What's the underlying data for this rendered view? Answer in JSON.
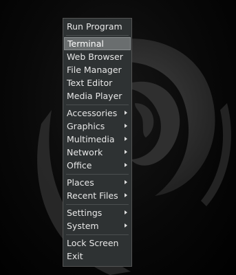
{
  "menu": {
    "run_program": "Run Program",
    "apps": [
      "Terminal",
      "Web Browser",
      "File Manager",
      "Text Editor",
      "Media Player"
    ],
    "categories": [
      "Accessories",
      "Graphics",
      "Multimedia",
      "Network",
      "Office"
    ],
    "locations": [
      "Places",
      "Recent Files"
    ],
    "system": [
      "Settings",
      "System"
    ],
    "session": [
      "Lock Screen",
      "Exit"
    ],
    "highlighted_item": "Terminal"
  },
  "colors": {
    "menu_bg": "#2e3233",
    "highlight_bg": "#6a6e6f",
    "text": "#e8e8e8",
    "swirl": "#3a3a3a"
  },
  "icons": {
    "desktop_logo": "debian-swirl-icon",
    "submenu_arrow": "chevron-right-icon"
  }
}
